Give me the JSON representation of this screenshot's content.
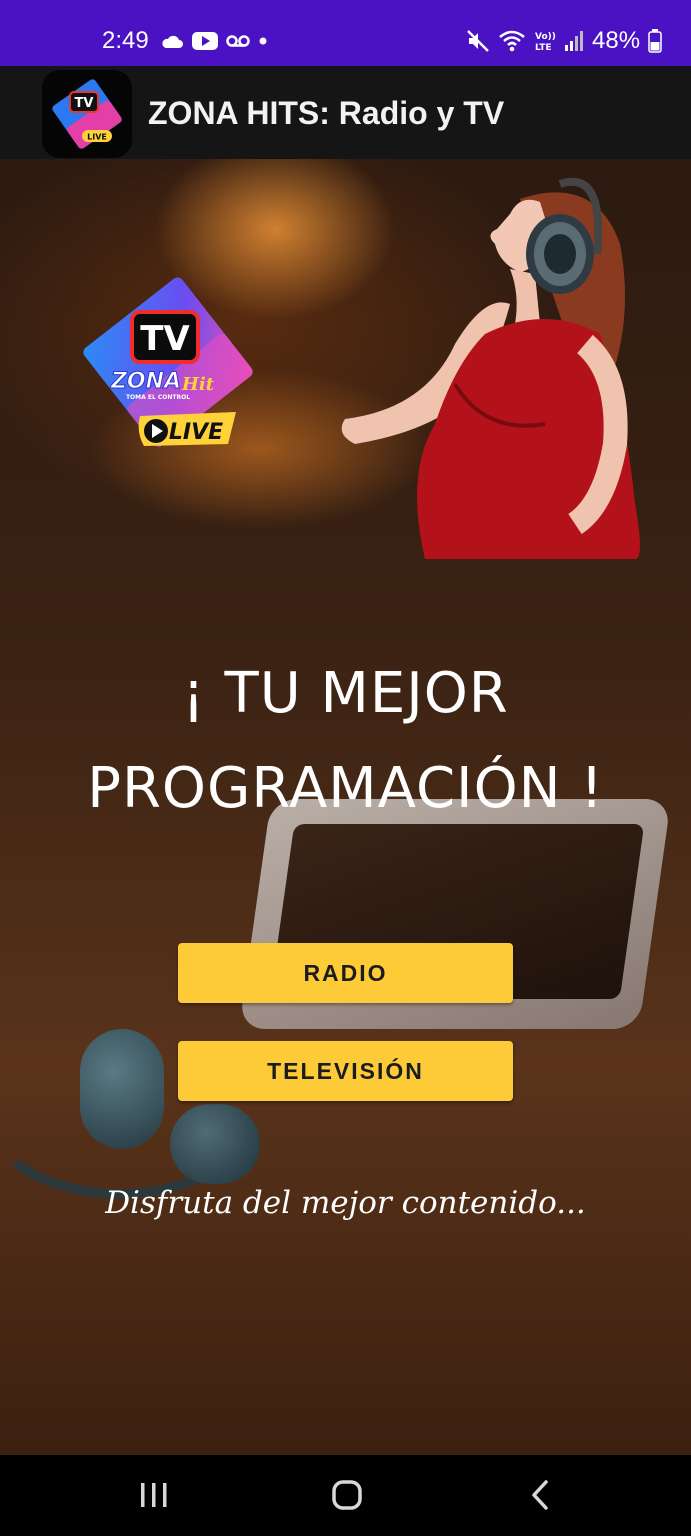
{
  "status_bar": {
    "time": "2:49",
    "battery_percent": "48%",
    "notification_icons": [
      "cloud-icon",
      "youtube-icon",
      "voicemail-icon",
      "dot-icon"
    ],
    "system_icons": [
      "mute-icon",
      "wifi-icon",
      "volte-icon",
      "signal-icon",
      "battery-icon"
    ]
  },
  "app_bar": {
    "title": "ZONA HITS: Radio y TV",
    "logo_icon": "zona-hits-logo-icon"
  },
  "hero": {
    "logo": {
      "tv_text": "TV",
      "brand_text": "ZONA",
      "hit_text": "Hit",
      "slogan": "TOMA EL CONTROL",
      "live_text": "LIVE"
    }
  },
  "headline": {
    "line1": "¡ TU MEJOR",
    "line2": "PROGRAMACIÓN !"
  },
  "buttons": {
    "radio_label": "RADIO",
    "tv_label": "TELEVISIÓN"
  },
  "tagline": "Disfruta del mejor contenido...",
  "nav_bar": {
    "icons": [
      "recents-icon",
      "home-icon",
      "back-icon"
    ]
  },
  "colors": {
    "status_bar": "#4a12c2",
    "app_bar": "#151515",
    "button": "#fdca38",
    "nav_bar": "#000000"
  }
}
